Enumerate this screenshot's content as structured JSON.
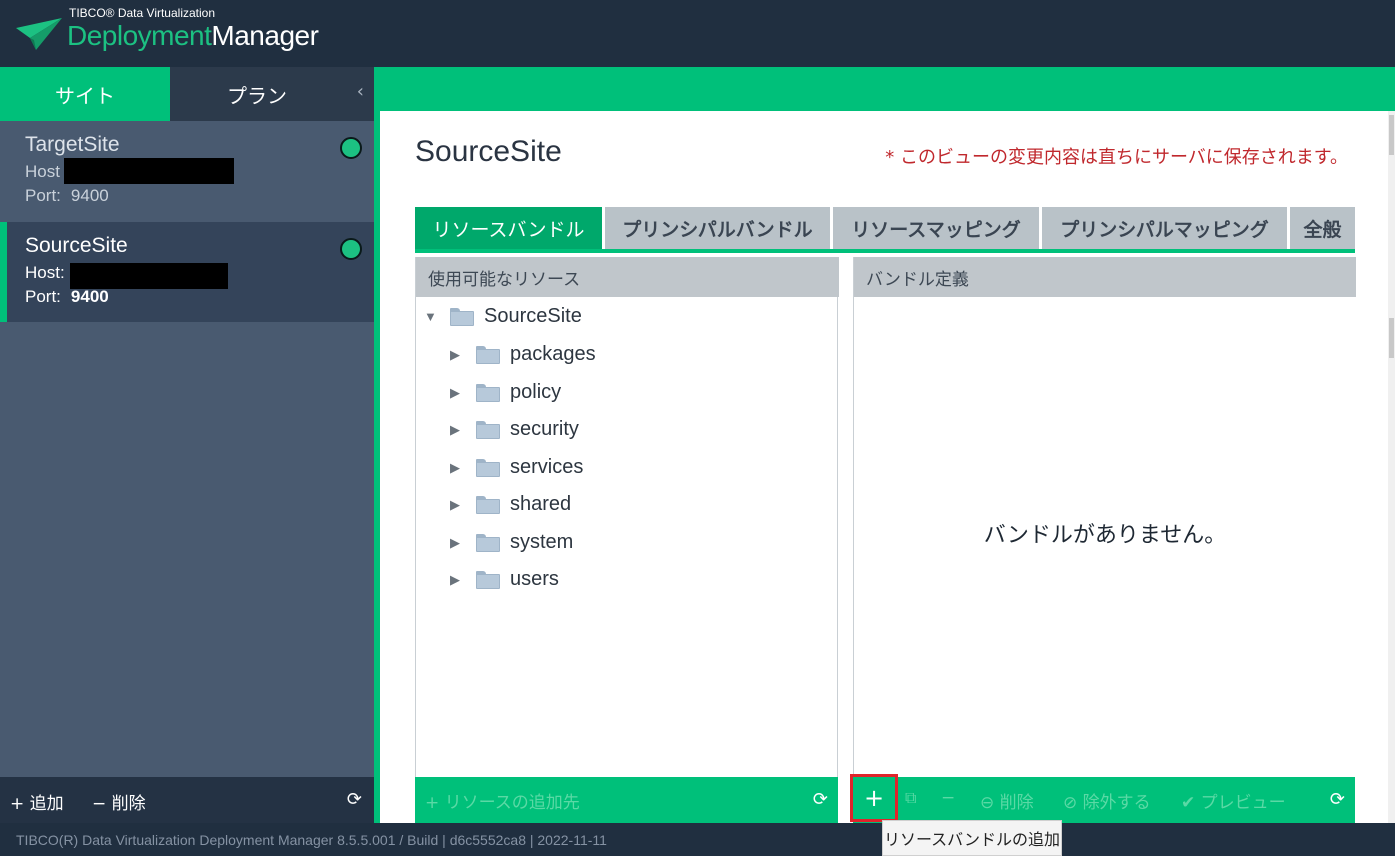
{
  "header": {
    "brand_small": "TIBCO® Data Virtualization",
    "brand_part1": "Deployment",
    "brand_part2": "Manager",
    "logo_icon": "paper-plane-icon"
  },
  "sidebar": {
    "tabs": [
      {
        "label": "サイト",
        "active": true
      },
      {
        "label": "プラン",
        "active": false
      }
    ],
    "collapse_icon": "chevron-left-icon",
    "sites": [
      {
        "name": "TargetSite",
        "host_label": "Host",
        "port_label": "Port:",
        "port": "9400",
        "status": "online",
        "selected": false
      },
      {
        "name": "SourceSite",
        "host_label": "Host:",
        "port_label": "Port:",
        "port": "9400",
        "status": "online",
        "selected": true
      }
    ],
    "footer": {
      "add_label": "+ 追加",
      "delete_label": "− 削除",
      "refresh_icon": "refresh-icon"
    }
  },
  "main": {
    "title": "SourceSite",
    "save_note": "* このビューの変更内容は直ちにサーバに保存されます。",
    "tabs": [
      {
        "label": "リソースバンドル",
        "active": true
      },
      {
        "label": "プリンシパルバンドル",
        "active": false
      },
      {
        "label": "リソースマッピング",
        "active": false
      },
      {
        "label": "プリンシパルマッピング",
        "active": false
      },
      {
        "label": "全般",
        "active": false
      }
    ],
    "left_panel": {
      "header": "使用可能なリソース",
      "root": "SourceSite",
      "children": [
        "packages",
        "policy",
        "security",
        "services",
        "shared",
        "system",
        "users"
      ],
      "bottom_action": "+ リソースの追加先"
    },
    "right_panel": {
      "header": "バンドル定義",
      "empty_message": "バンドルがありません。",
      "actions": {
        "add": "+",
        "copy_icon": "copy-icon",
        "minus": "−",
        "delete": "削除",
        "exclude": "除外する",
        "preview": "プレビュー"
      }
    }
  },
  "footer": {
    "version_text": "TIBCO(R) Data Virtualization Deployment Manager 8.5.5.001 / Build | d6c5552ca8 | 2022-11-11"
  },
  "tooltip": {
    "text": "リソースバンドルの追加"
  },
  "colors": {
    "accent": "#00c07a",
    "header_bg": "#202f40",
    "sidebar_bg": "#495a70",
    "warning_text": "#c0282d"
  }
}
